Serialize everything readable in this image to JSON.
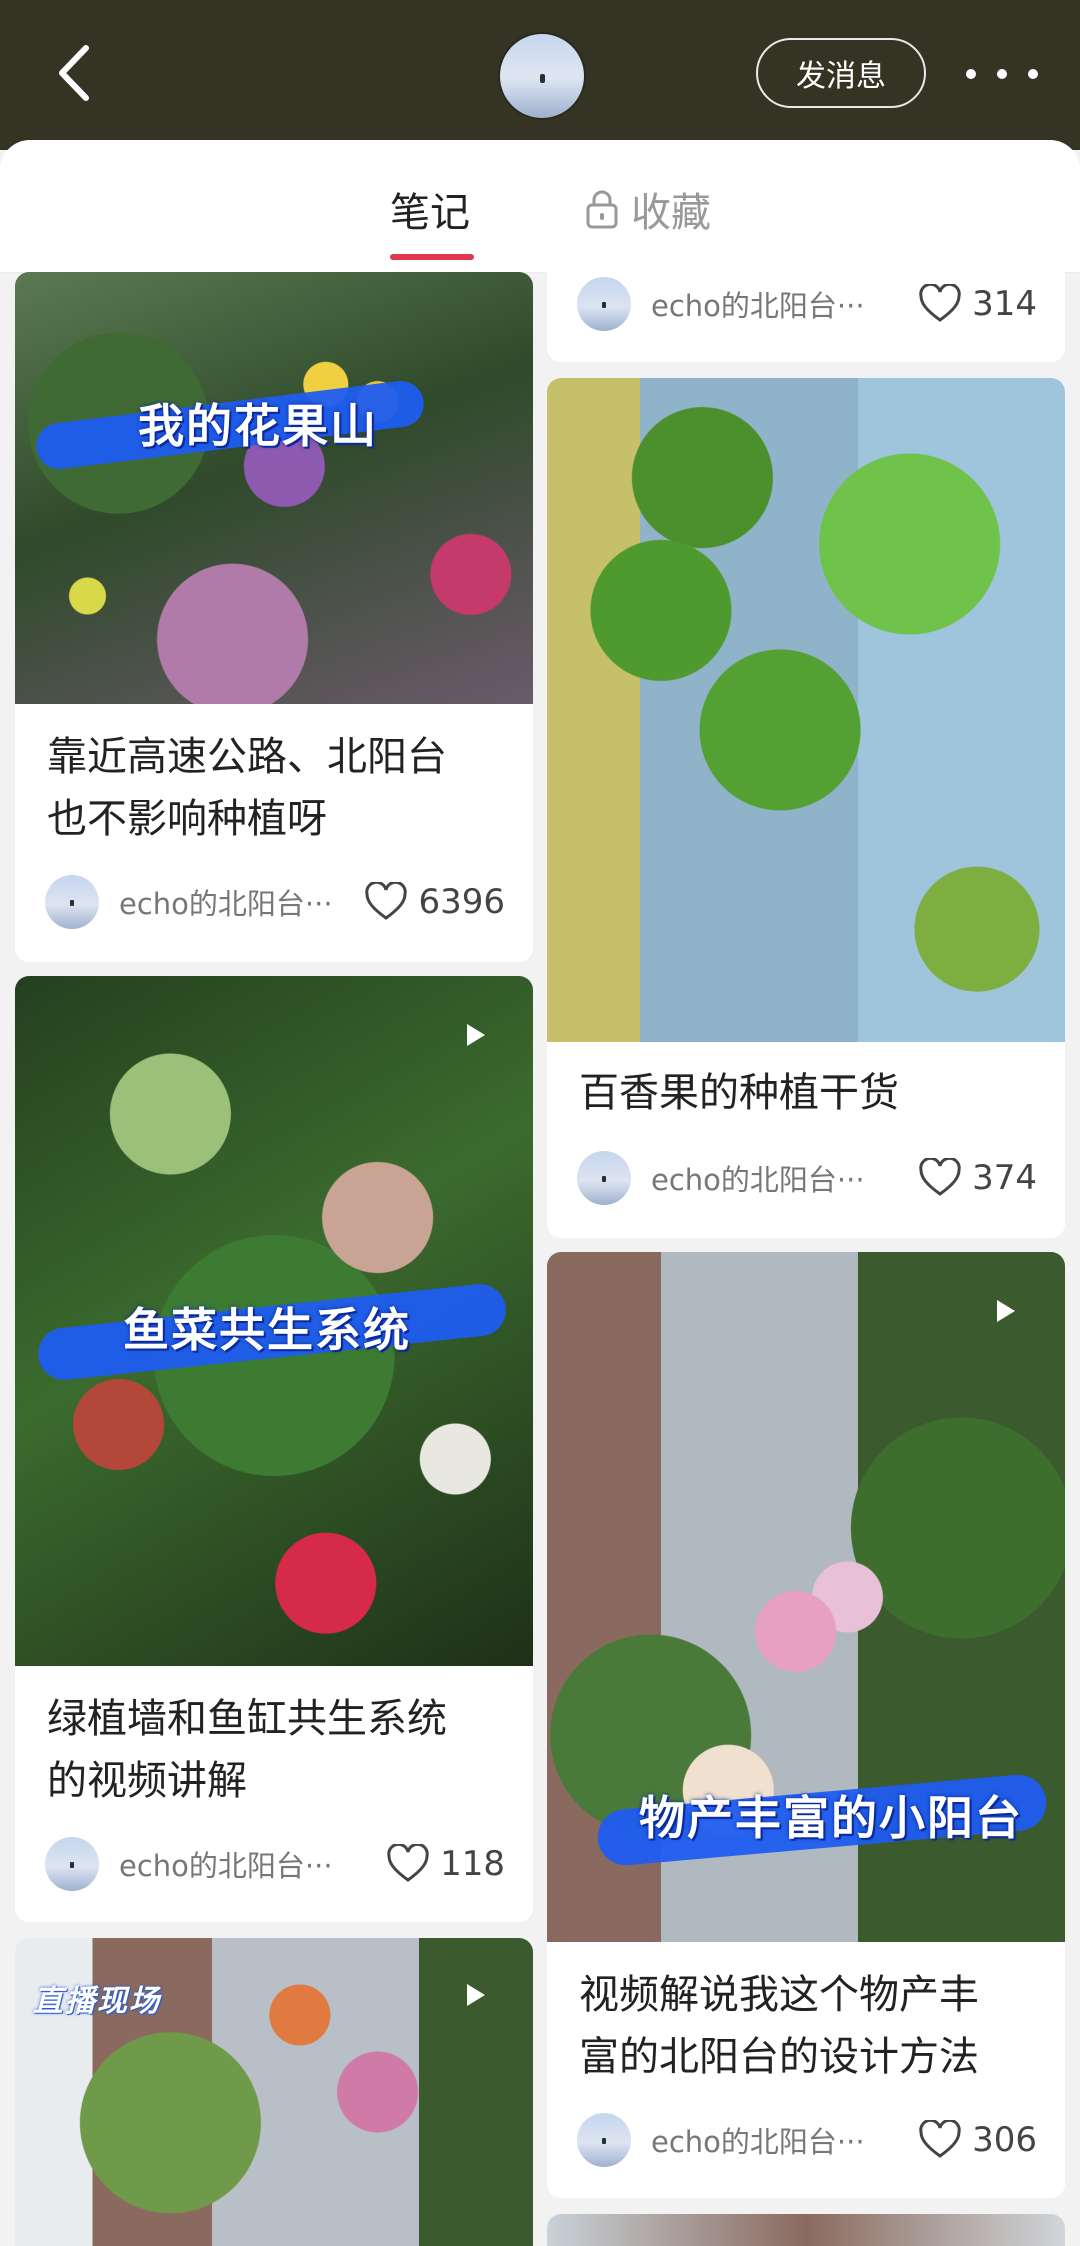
{
  "header": {
    "send_message_label": "发消息"
  },
  "tabs": {
    "notes": "笔记",
    "favorites": "收藏"
  },
  "cards": {
    "c1": {
      "overlay": "我的花果山",
      "title_line1": "靠近高速公路、北阳台",
      "title_line2": "也不影响种植呀",
      "author": "echo的北阳台···",
      "likes": "6396"
    },
    "c2": {
      "author": "echo的北阳台···",
      "likes": "314"
    },
    "c3": {
      "title_line1": "百香果的种植干货",
      "author": "echo的北阳台···",
      "likes": "374"
    },
    "c4": {
      "overlay": "鱼菜共生系统",
      "title_line1": "绿植墙和鱼缸共生系统",
      "title_line2": "的视频讲解",
      "author": "echo的北阳台···",
      "likes": "118"
    },
    "c5": {
      "overlay": "物产丰富的小阳台",
      "title_line1": "视频解说我这个物产丰",
      "title_line2": "富的北阳台的设计方法",
      "author": "echo的北阳台···",
      "likes": "306"
    },
    "c6": {
      "overlay": "直播现场"
    }
  },
  "colors": {
    "header_bg": "#353424",
    "accent": "#e2364f",
    "overlay_stroke": "#1f5df0"
  },
  "icons": [
    "back-arrow-icon",
    "more-dots-icon",
    "lock-icon",
    "heart-icon",
    "play-icon"
  ]
}
